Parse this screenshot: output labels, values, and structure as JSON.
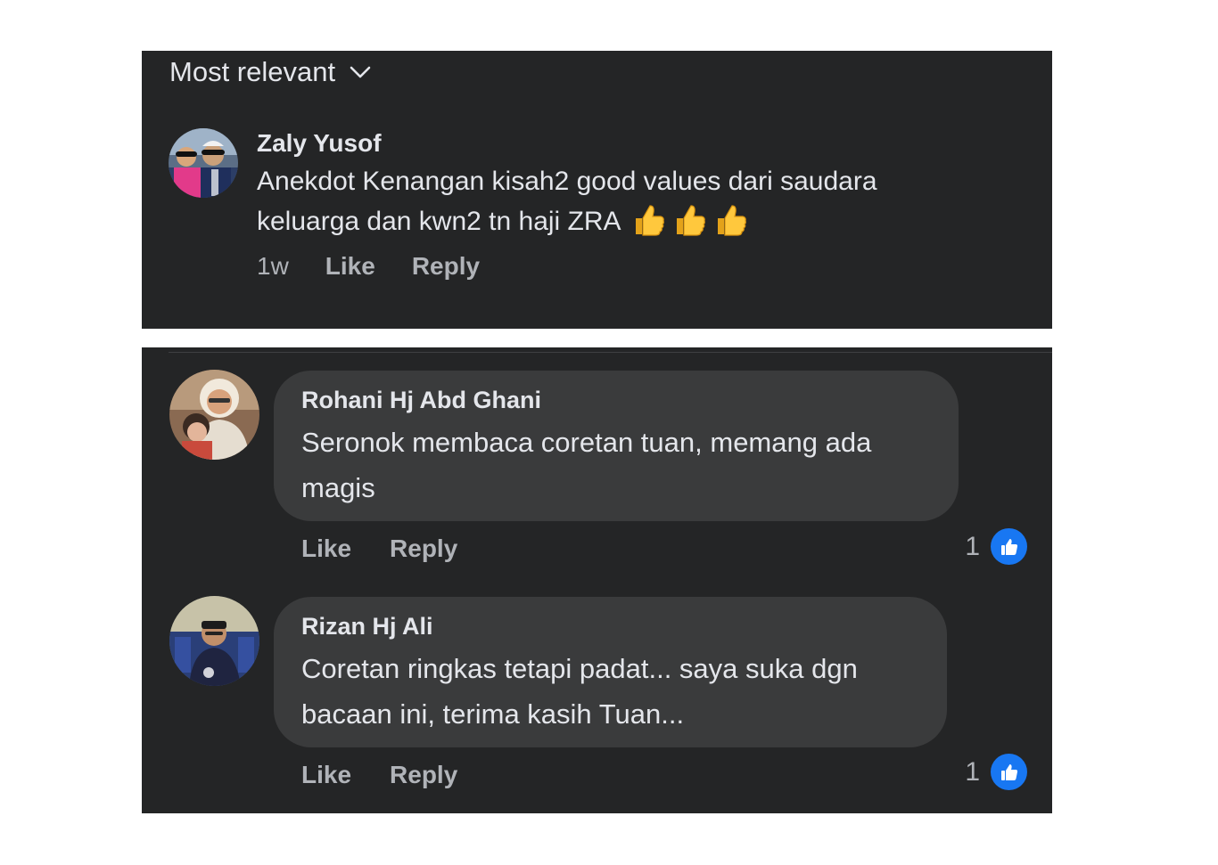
{
  "sort": {
    "label": "Most relevant"
  },
  "comments": [
    {
      "author": "Zaly Yusof",
      "line1": "Anekdot Kenangan kisah2 good values dari saudara",
      "line2": "keluarga dan kwn2 tn haji ZRA",
      "emoji": "thumbs-up-emoji",
      "time": "1w",
      "like_label": "Like",
      "reply_label": "Reply"
    },
    {
      "author": "Rohani Hj Abd Ghani",
      "line1": "Seronok membaca coretan tuan, memang ada",
      "line2": "magis",
      "like_label": "Like",
      "reply_label": "Reply",
      "reaction_count": "1"
    },
    {
      "author": "Rizan Hj Ali",
      "line1": "Coretan ringkas tetapi padat... saya suka dgn",
      "line2": "bacaan ini, terima kasih Tuan...",
      "like_label": "Like",
      "reply_label": "Reply",
      "reaction_count": "1"
    }
  ],
  "colors": {
    "panel_bg": "#242526",
    "bubble_bg": "#3a3b3c",
    "primary_text": "#e4e6eb",
    "secondary_text": "#b0b3b8",
    "like_blue": "#1877f2"
  }
}
